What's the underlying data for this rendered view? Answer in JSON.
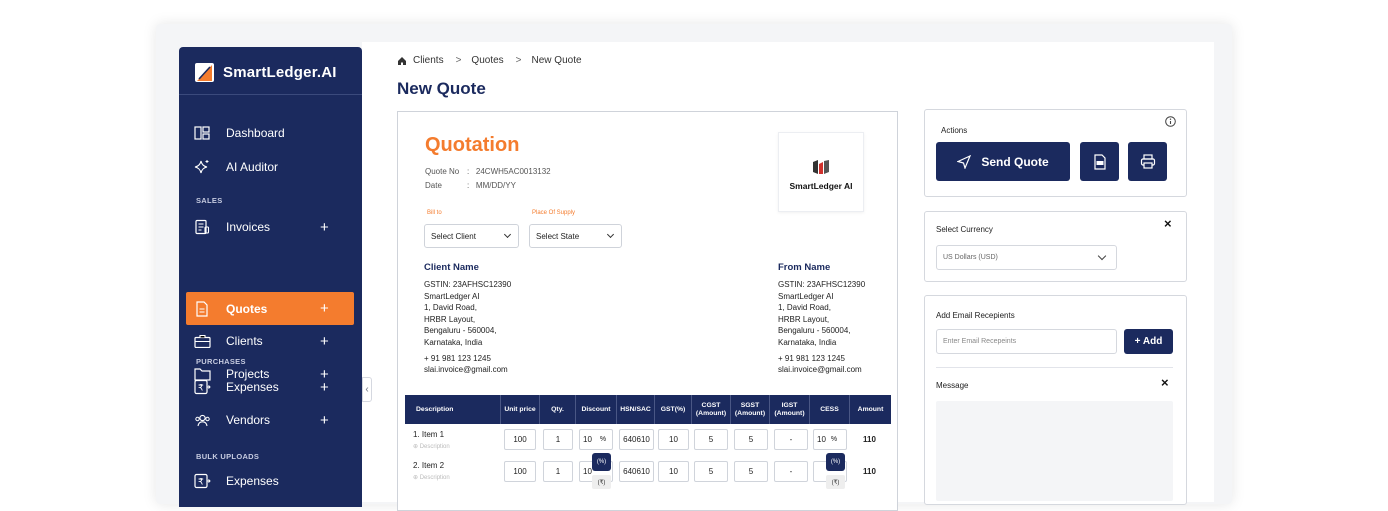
{
  "app": {
    "name": "SmartLedger.AI"
  },
  "sidebar": {
    "dashboard": "Dashboard",
    "ai_auditor": "AI Auditor",
    "sec_sales": "SALES",
    "invoices": "Invoices",
    "quotes": "Quotes",
    "clients": "Clients",
    "projects": "Projects",
    "sec_purchases": "PURCHASES",
    "expenses": "Expenses",
    "vendors": "Vendors",
    "sec_bulk": "BULK UPLOADS",
    "bulk_expenses": "Expenses",
    "plus": "+"
  },
  "breadcrumb": {
    "items": [
      "Clients",
      "Quotes",
      "New Quote"
    ],
    "sep": ">"
  },
  "page": {
    "title": "New Quote"
  },
  "quote": {
    "title": "Quotation",
    "quote_no_label": "Quote No",
    ":": ":",
    "quote_no": "24CWH5AC0013132",
    "date_label": "Date",
    "date": "MM/DD/YY",
    "bill_to_label": "Bill to",
    "bill_to_value": "Select Client",
    "supply_label": "Place Of Supply",
    "supply_value": "Select State",
    "logo_text": "SmartLedger AI",
    "client": {
      "heading": "Client Name",
      "lines": [
        "GSTIN: 23AFHSC12390",
        "SmartLedger AI",
        "1, David Road,",
        "HRBR Layout,",
        "Bengaluru - 560004,",
        "Karnataka, India"
      ],
      "phone": "+ 91  981 123 1245",
      "email": "slai.invoice@gmail.com"
    },
    "from": {
      "heading": "From Name",
      "lines": [
        "GSTIN: 23AFHSC12390",
        "SmartLedger AI",
        "1, David Road,",
        "HRBR Layout,",
        "Bengaluru - 560004,",
        "Karnataka, India"
      ],
      "phone": "+ 91  981 123 1245",
      "email": "slai.invoice@gmail.com"
    }
  },
  "table": {
    "headers": [
      "Description",
      "Unit price",
      "Qty.",
      "Discount",
      "HSN/SAC",
      "GST(%)",
      "CGST (Amount)",
      "SGST (Amount)",
      "IGST (Amount)",
      "CESS",
      "Amount"
    ],
    "rows": [
      {
        "desc": "1. Item 1",
        "sub": "Description",
        "unit": "100",
        "qty": "1",
        "discount": "10",
        "disc_unit": "%",
        "hsn": "640610",
        "gst": "10",
        "cgst": "5",
        "sgst": "5",
        "igst": "-",
        "cess": "10",
        "cess_unit": "%",
        "amount": "110"
      },
      {
        "desc": "2. Item 2",
        "sub": "Description",
        "unit": "100",
        "qty": "1",
        "discount": "10",
        "hsn": "640610",
        "gst": "10",
        "cgst": "5",
        "sgst": "5",
        "igst": "-",
        "cess": "",
        "amount": "110"
      }
    ],
    "tip_pct": "(%)",
    "tip_rs": "(₹)"
  },
  "actions": {
    "title": "Actions",
    "send_quote": "Send Quote"
  },
  "currency": {
    "title": "Select Currency",
    "value": "US Dollars (USD)"
  },
  "email": {
    "title": "Add Email Recepients",
    "placeholder": "Enter Email Recepeints",
    "add_label": "+ Add"
  },
  "message": {
    "title": "Message"
  }
}
